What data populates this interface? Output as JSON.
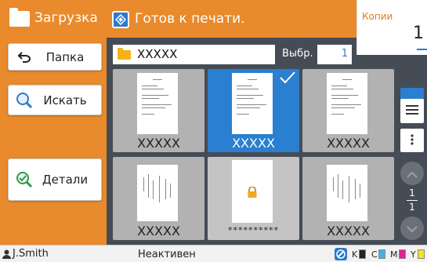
{
  "left_panel": {
    "title": "Загрузка",
    "buttons": [
      {
        "label": "Папка",
        "icon": "back-arrow-icon"
      },
      {
        "label": "Искать",
        "icon": "search-icon"
      },
      {
        "label": "Детали",
        "icon": "details-check-icon"
      }
    ]
  },
  "header": {
    "title": "Готов к печати.",
    "copies_label": "Копии",
    "copies_value": "1"
  },
  "path": {
    "folder_name": "XXXXX",
    "select_label": "Выбр.",
    "select_count": "1"
  },
  "thumbnails": [
    {
      "name": "XXXXX",
      "selected": false,
      "locked": false
    },
    {
      "name": "XXXXX",
      "selected": true,
      "locked": false
    },
    {
      "name": "XXXXX",
      "selected": false,
      "locked": false
    },
    {
      "name": "XXXXX",
      "selected": false,
      "locked": false
    },
    {
      "name": "**********",
      "selected": false,
      "locked": true
    },
    {
      "name": "XXXXX",
      "selected": false,
      "locked": false
    }
  ],
  "view_controls": {
    "page_current": "1",
    "page_total": "1"
  },
  "status_bar": {
    "user": "J.Smith",
    "status": "Неактивен",
    "ink_labels": [
      "K",
      "C",
      "M",
      "Y"
    ]
  },
  "colors": {
    "accent_orange": "#e98a2c",
    "accent_blue": "#2a7fd0",
    "dark_bg": "#454c56"
  }
}
